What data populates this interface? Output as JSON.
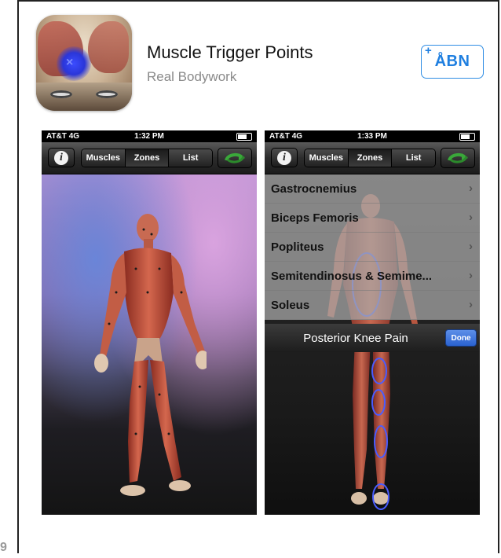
{
  "app": {
    "title": "Muscle Trigger Points",
    "developer": "Real Bodywork",
    "open_label": "ÅBN",
    "open_plus": "+"
  },
  "corner_char": "9",
  "screenshots": [
    {
      "status": {
        "carrier": "AT&T 4G",
        "time": "1:32 PM"
      },
      "info_label": "i",
      "segments": [
        "Muscles",
        "Zones",
        "List"
      ],
      "active_segment": "Zones"
    },
    {
      "status": {
        "carrier": "AT&T 4G",
        "time": "1:33 PM"
      },
      "info_label": "i",
      "segments": [
        "Muscles",
        "Zones",
        "List"
      ],
      "active_segment": "Zones",
      "list_items": [
        "Gastrocnemius",
        "Biceps Femoris",
        "Popliteus",
        "Semitendinosus & Semime...",
        "Soleus"
      ],
      "chevron": "›",
      "picker_title": "Posterior Knee Pain",
      "done_label": "Done"
    }
  ],
  "colors": {
    "accent": "#1f7fe0",
    "done_button": "#2a62d0"
  }
}
